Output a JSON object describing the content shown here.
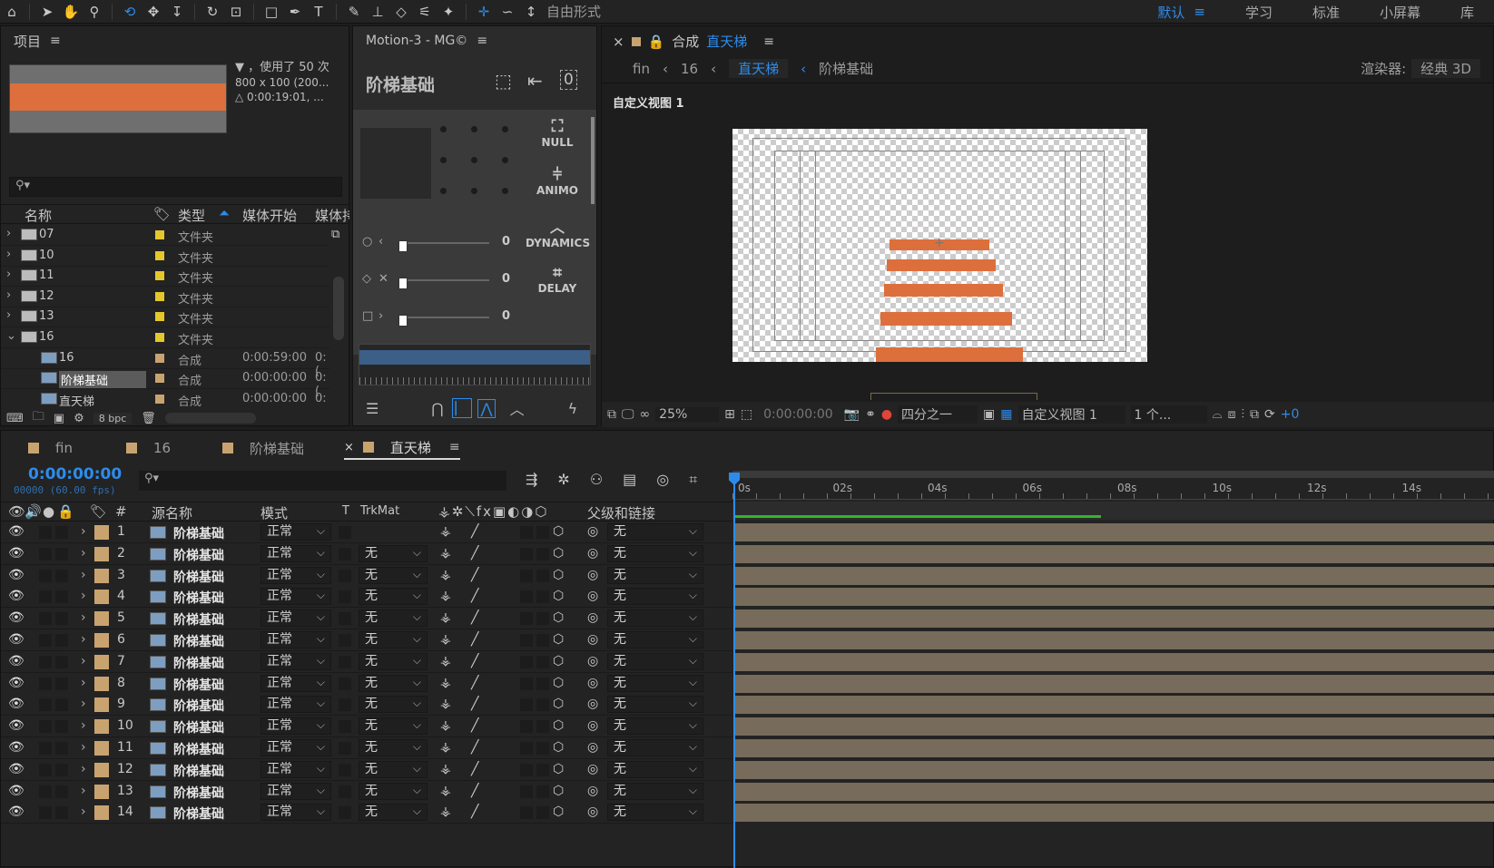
{
  "toolbar": {
    "mode_label": "自由形式",
    "workspaces": [
      "默认",
      "学习",
      "标准",
      "小屏幕",
      "库"
    ],
    "workspaces_menu_icon": "≡"
  },
  "project": {
    "title": "项目",
    "info_line1": "▼ ，使用了 50 次",
    "info_line2": "800 x 100 (200...",
    "info_line3": "△ 0:00:19:01, ...",
    "search_placeholder": "",
    "columns": [
      "名称",
      "类型",
      "媒体开始",
      "媒体持"
    ],
    "items": [
      {
        "name": "07",
        "type": "文件夹",
        "start": "",
        "kind": "folder"
      },
      {
        "name": "10",
        "type": "文件夹",
        "start": "",
        "kind": "folder"
      },
      {
        "name": "11",
        "type": "文件夹",
        "start": "",
        "kind": "folder"
      },
      {
        "name": "12",
        "type": "文件夹",
        "start": "",
        "kind": "folder"
      },
      {
        "name": "13",
        "type": "文件夹",
        "start": "",
        "kind": "folder"
      },
      {
        "name": "16",
        "type": "文件夹",
        "start": "",
        "kind": "folder-open"
      },
      {
        "name": "16",
        "type": "合成",
        "start": "0:00:59:00",
        "extra": "0:(",
        "kind": "comp"
      },
      {
        "name": "阶梯基础",
        "type": "合成",
        "start": "0:00:00:00",
        "extra": "0:(",
        "kind": "comp",
        "selected": true
      },
      {
        "name": "直天梯",
        "type": "合成",
        "start": "0:00:00:00",
        "extra": "0:(",
        "kind": "comp"
      }
    ],
    "bpc": "8 bpc"
  },
  "motion": {
    "title": "Motion-3 - MG©",
    "subtitle": "阶梯基础",
    "buttons": [
      "NULL",
      "ANIMO",
      "DYNAMICS",
      "DELAY"
    ],
    "sliders": [
      {
        "value": "0",
        "level": 0.05
      },
      {
        "value": "0",
        "level": 0.05
      },
      {
        "value": "0",
        "level": 0.05
      }
    ]
  },
  "composition": {
    "title": "合成",
    "comp_name": "直天梯",
    "breadcrumb": [
      "fin",
      "16",
      "直天梯",
      "阶梯基础"
    ],
    "renderer_label": "渲染器:",
    "renderer_value": "经典 3D",
    "view_label": "自定义视图 1",
    "zoom": "25%",
    "timecode": "0:00:00:00",
    "resolution": "四分之一",
    "view_select": "自定义视图 1",
    "views_count": "1 个...",
    "exposure": "+0"
  },
  "timeline": {
    "tabs": [
      {
        "label": "fin"
      },
      {
        "label": "16"
      },
      {
        "label": "阶梯基础"
      },
      {
        "label": "直天梯",
        "active": true
      }
    ],
    "timecode": "0:00:00:00",
    "frame_info": "00000 (60.00 fps)",
    "columns": {
      "source": "源名称",
      "mode": "模式",
      "t": "T",
      "trkmat": "TrkMat",
      "parent": "父级和链接"
    },
    "ruler": [
      "0s",
      "02s",
      "04s",
      "06s",
      "08s",
      "10s",
      "12s",
      "14s"
    ],
    "layers": [
      {
        "num": "1",
        "name": "阶梯基础",
        "mode": "正常",
        "trkmat": "",
        "parent": "无"
      },
      {
        "num": "2",
        "name": "阶梯基础",
        "mode": "正常",
        "trkmat": "无",
        "parent": "无"
      },
      {
        "num": "3",
        "name": "阶梯基础",
        "mode": "正常",
        "trkmat": "无",
        "parent": "无"
      },
      {
        "num": "4",
        "name": "阶梯基础",
        "mode": "正常",
        "trkmat": "无",
        "parent": "无"
      },
      {
        "num": "5",
        "name": "阶梯基础",
        "mode": "正常",
        "trkmat": "无",
        "parent": "无"
      },
      {
        "num": "6",
        "name": "阶梯基础",
        "mode": "正常",
        "trkmat": "无",
        "parent": "无"
      },
      {
        "num": "7",
        "name": "阶梯基础",
        "mode": "正常",
        "trkmat": "无",
        "parent": "无"
      },
      {
        "num": "8",
        "name": "阶梯基础",
        "mode": "正常",
        "trkmat": "无",
        "parent": "无"
      },
      {
        "num": "9",
        "name": "阶梯基础",
        "mode": "正常",
        "trkmat": "无",
        "parent": "无"
      },
      {
        "num": "10",
        "name": "阶梯基础",
        "mode": "正常",
        "trkmat": "无",
        "parent": "无"
      },
      {
        "num": "11",
        "name": "阶梯基础",
        "mode": "正常",
        "trkmat": "无",
        "parent": "无"
      },
      {
        "num": "12",
        "name": "阶梯基础",
        "mode": "正常",
        "trkmat": "无",
        "parent": "无"
      },
      {
        "num": "13",
        "name": "阶梯基础",
        "mode": "正常",
        "trkmat": "无",
        "parent": "无"
      },
      {
        "num": "14",
        "name": "阶梯基础",
        "mode": "正常",
        "trkmat": "无",
        "parent": "无"
      }
    ]
  },
  "colors": {
    "accent": "#2d8ceb",
    "layer_orange": "#dd6f3c",
    "folder_yellow": "#e4c72c",
    "layer_label": "#c9a36f",
    "track_bar": "#776b5b",
    "work_area": "#33b52f"
  }
}
